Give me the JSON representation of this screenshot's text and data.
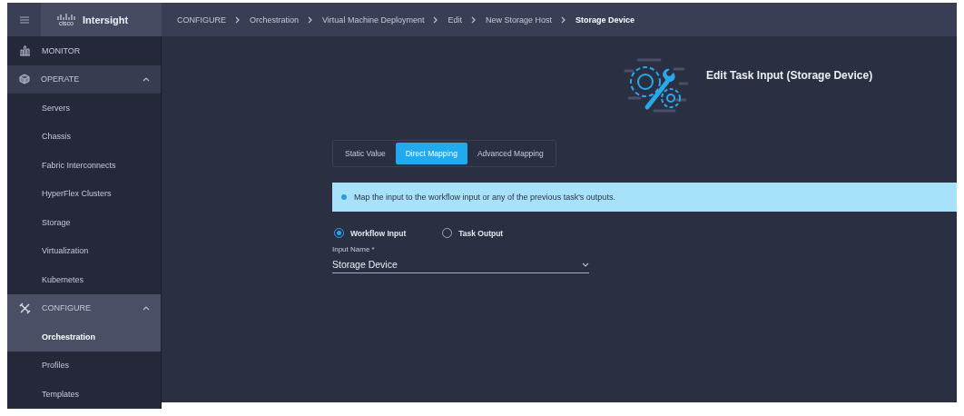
{
  "header": {
    "logo_text": "cisco",
    "app_name": "Intersight",
    "breadcrumb": [
      "CONFIGURE",
      "Orchestration",
      "Virtual Machine Deployment",
      "Edit",
      "New Storage Host",
      "Storage Device"
    ]
  },
  "sidebar": {
    "items": [
      {
        "kind": "heading",
        "label": "MONITOR"
      },
      {
        "kind": "group",
        "label": "OPERATE",
        "expanded": true,
        "selected": false,
        "children": [
          {
            "label": "Servers",
            "selected": false
          },
          {
            "label": "Chassis",
            "selected": false
          },
          {
            "label": "Fabric Interconnects",
            "selected": false
          },
          {
            "label": "HyperFlex Clusters",
            "selected": false
          },
          {
            "label": "Storage",
            "selected": false
          },
          {
            "label": "Virtualization",
            "selected": false
          },
          {
            "label": "Kubernetes",
            "selected": false
          }
        ]
      },
      {
        "kind": "group",
        "label": "CONFIGURE",
        "expanded": true,
        "selected": true,
        "children": [
          {
            "label": "Orchestration",
            "selected": true
          },
          {
            "label": "Profiles",
            "selected": false
          },
          {
            "label": "Templates",
            "selected": false
          }
        ]
      }
    ]
  },
  "editor": {
    "title": "Edit Task Input (Storage Device)",
    "tabs": [
      {
        "label": "Static Value",
        "selected": false
      },
      {
        "label": "Direct Mapping",
        "selected": true
      },
      {
        "label": "Advanced Mapping",
        "selected": false
      }
    ],
    "info": "Map the input to the workflow input or any of the previous task's outputs.",
    "radios": [
      {
        "label": "Workflow Input",
        "selected": true
      },
      {
        "label": "Task Output",
        "selected": false
      }
    ],
    "field": {
      "label": "Input Name *",
      "value": "Storage Device"
    }
  }
}
